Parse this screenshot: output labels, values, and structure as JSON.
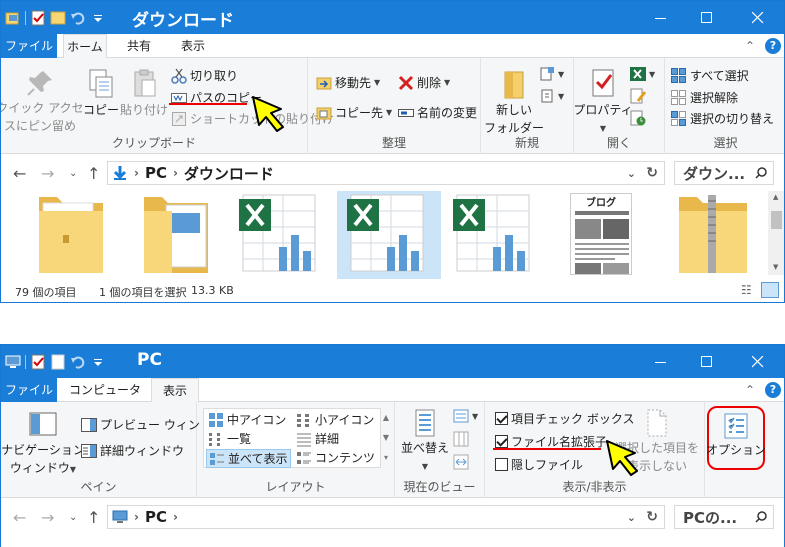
{
  "window1": {
    "title": "ダウンロード",
    "tabs": [
      "ファイル",
      "ホーム",
      "共有",
      "表示"
    ],
    "ribbon": {
      "clipboard": {
        "pin_label_1": "クイック アクセ",
        "pin_label_2": "スにピン留め",
        "copy_label": "コピー",
        "paste_label": "貼り付け",
        "cut_label": "切り取り",
        "copy_path_label": "パスのコピー",
        "paste_shortcut_label": "ショートカットの貼り付け",
        "group_label": "クリップボード"
      },
      "organize": {
        "move_to_label": "移動先",
        "delete_label": "削除",
        "copy_to_label": "コピー先",
        "rename_label": "名前の変更",
        "group_label": "整理"
      },
      "new": {
        "new_folder_label_1": "新しい",
        "new_folder_label_2": "フォルダー",
        "group_label": "新規"
      },
      "open": {
        "properties_label": "プロパティ",
        "group_label": "開く"
      },
      "select": {
        "select_all_label": "すべて選択",
        "select_none_label": "選択解除",
        "invert_label": "選択の切り替え",
        "group_label": "選択"
      }
    },
    "address": {
      "root": "PC",
      "current": "ダウンロード",
      "search_placeholder": "ダウン..."
    },
    "status": {
      "item_count": "79 個の項目",
      "selection": "1 個の項目を選択",
      "size": "13.3 KB"
    },
    "thumbnail_text": "ブログ"
  },
  "window2": {
    "title": "PC",
    "tabs": [
      "ファイル",
      "コンピューター",
      "表示"
    ],
    "ribbon": {
      "pane": {
        "nav_pane_label_1": "ナビゲーション",
        "nav_pane_label_2": "ウィンドウ",
        "preview_label": "プレビュー ウィンドウ",
        "details_pane_label": "詳細ウィンドウ",
        "group_label": "ペイン"
      },
      "layout": {
        "items": [
          "中アイコン",
          "小アイコン",
          "一覧",
          "詳細",
          "並べて表示",
          "コンテンツ"
        ],
        "group_label": "レイアウト"
      },
      "current_view": {
        "sort_label": "並べ替え",
        "group_label": "現在のビュー"
      },
      "show_hide": {
        "item_checkbox_label": "項目チェック ボックス",
        "extensions_label": "ファイル名拡張子",
        "hidden_label": "隠しファイル",
        "hide_selected_label_1": "選択した項目を",
        "hide_selected_label_2": "表示しない",
        "group_label": "表示/非表示",
        "item_checkbox_checked": true,
        "extensions_checked": true,
        "hidden_checked": false
      },
      "options_label": "オプション"
    },
    "address": {
      "root": "PC",
      "search_placeholder": "PCの..."
    }
  },
  "colors": {
    "titlebar": "#1a7ed8",
    "highlight_red": "#e00000",
    "cursor_yellow": "#ffff00",
    "folder": "#f5cf6a",
    "excel_green": "#1f7244"
  }
}
